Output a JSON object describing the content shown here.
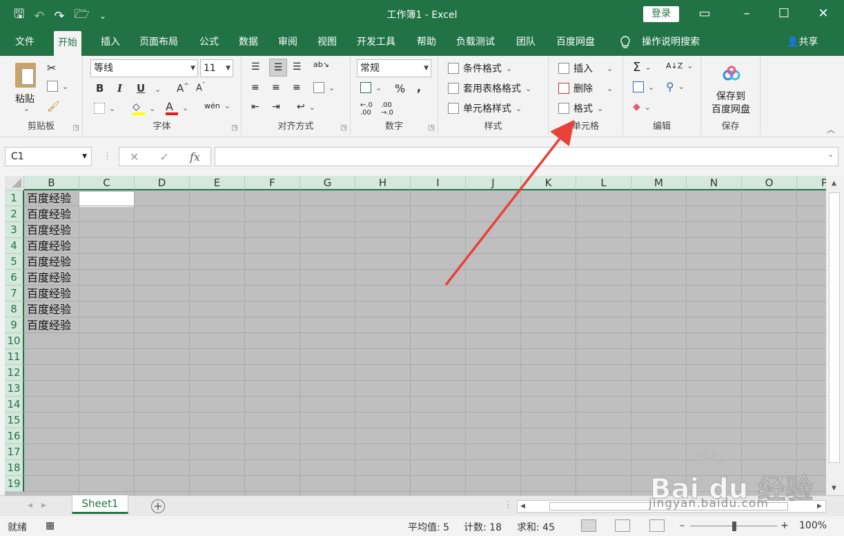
{
  "titlebar": {
    "title": "工作簿1  -  Excel",
    "signin": "登录"
  },
  "tabs": [
    "文件",
    "开始",
    "插入",
    "页面布局",
    "公式",
    "数据",
    "审阅",
    "视图",
    "开发工具",
    "帮助",
    "负载测试",
    "团队",
    "百度网盘"
  ],
  "tellme": "操作说明搜索",
  "share": "共享",
  "ribbon": {
    "clipboard": {
      "paste": "粘贴",
      "label": "剪贴板"
    },
    "font": {
      "name": "等线",
      "size": "11",
      "label": "字体"
    },
    "alignment": {
      "label": "对齐方式"
    },
    "number": {
      "format": "常规",
      "label": "数字"
    },
    "styles": {
      "conditional": "条件格式",
      "table": "套用表格格式",
      "cell": "单元格样式",
      "label": "样式"
    },
    "cells": {
      "insert": "插入",
      "delete": "删除",
      "format": "格式",
      "label": "单元格"
    },
    "editing": {
      "label": "编辑"
    },
    "save": {
      "line1": "保存到",
      "line2": "百度网盘",
      "label": "保存"
    }
  },
  "formula_bar": {
    "namebox": "C1",
    "fx": "fx",
    "value": ""
  },
  "grid": {
    "columns": [
      "B",
      "C",
      "D",
      "E",
      "F",
      "G",
      "H",
      "I",
      "J",
      "K",
      "L",
      "M",
      "N",
      "O",
      "P"
    ],
    "rows": [
      "1",
      "2",
      "3",
      "4",
      "5",
      "6",
      "7",
      "8",
      "9",
      "10",
      "11",
      "12",
      "13",
      "14",
      "15",
      "16",
      "17",
      "18",
      "19"
    ],
    "b_values": [
      "百度经验",
      "百度经验",
      "百度经验",
      "百度经验",
      "百度经验",
      "百度经验",
      "百度经验",
      "百度经验",
      "百度经验"
    ]
  },
  "sheets": {
    "active": "Sheet1"
  },
  "status": {
    "ready": "就绪",
    "average": "平均值: 5",
    "count": "计数: 18",
    "sum": "求和: 45",
    "zoom": "100%"
  },
  "watermark": {
    "brand": "Bai du 经验",
    "url": "jingyan.baidu.com"
  },
  "colors": {
    "accent": "#217346",
    "arrow": "#e8413a"
  }
}
